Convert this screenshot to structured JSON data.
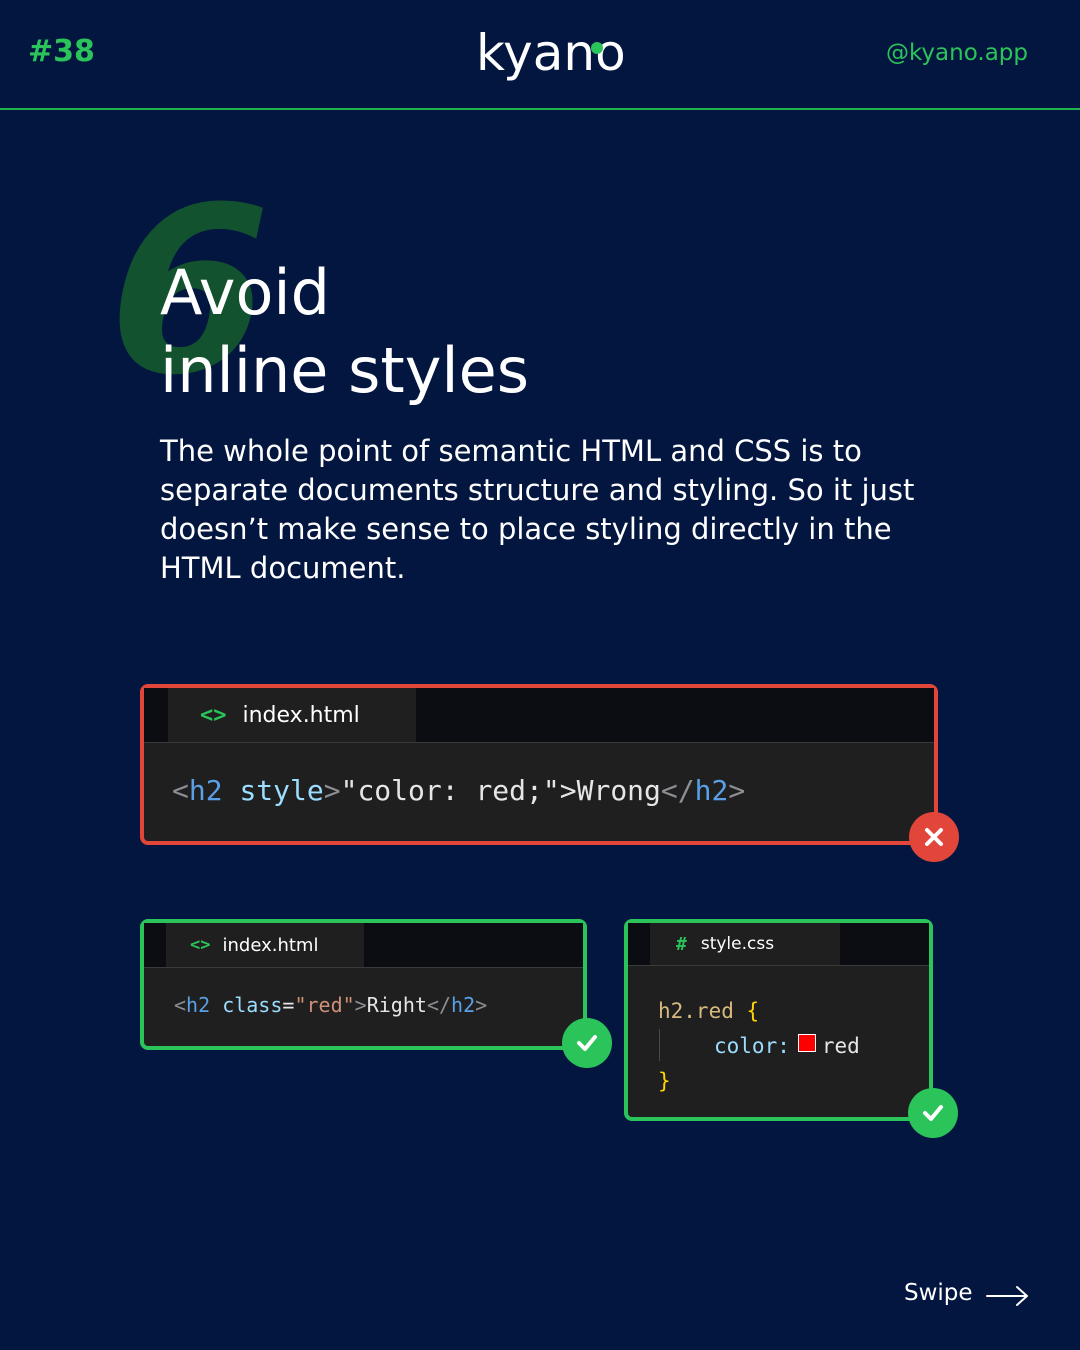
{
  "header": {
    "post_number": "#38",
    "logo": "kyano",
    "handle": "@kyano.app"
  },
  "tip": {
    "number": "6",
    "title_line1": "Avoid",
    "title_line2": "inline styles",
    "description": "The whole point of semantic HTML and CSS is to separate documents structure and styling. So it just doesn’t make sense to place styling directly in the HTML document."
  },
  "wrong_example": {
    "filename": "index.html",
    "code": {
      "open_lt": "<",
      "tag": "h2",
      "attr": "style",
      "gt": ">",
      "rest": "\"color: red;\">Wrong",
      "close_lt": "</",
      "close_tag": "h2",
      "close_gt": ">"
    },
    "status": "wrong"
  },
  "right_html_example": {
    "filename": "index.html",
    "code": {
      "open_lt": "<",
      "tag": "h2",
      "attr": "class",
      "eq": "=",
      "value": "\"red\"",
      "gt": ">",
      "text": "Right",
      "close_lt": "</",
      "close_tag": "h2",
      "close_gt": ">"
    },
    "status": "right"
  },
  "right_css_example": {
    "filename": "style.css",
    "code": {
      "selector": "h2.red",
      "open_brace": "{",
      "property": "color:",
      "value": "red",
      "close_brace": "}"
    },
    "swatch_color": "#ff0000",
    "status": "right"
  },
  "footer": {
    "swipe_label": "Swipe"
  },
  "colors": {
    "background": "#031640",
    "accent_green": "#2bc45a",
    "error_red": "#e2463b"
  }
}
